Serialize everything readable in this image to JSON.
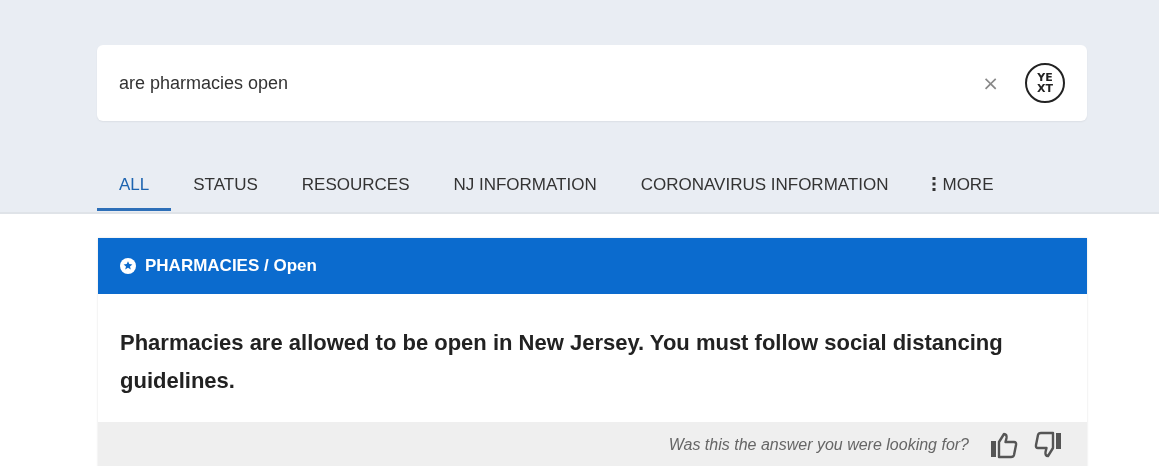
{
  "search": {
    "value": "are pharmacies open",
    "clear": "×",
    "logo_lines": [
      "YE",
      "XT"
    ]
  },
  "tabs": [
    {
      "label": "ALL",
      "selected": true
    },
    {
      "label": "STATUS",
      "selected": false
    },
    {
      "label": "RESOURCES",
      "selected": false
    },
    {
      "label": "NJ INFORMATION",
      "selected": false
    },
    {
      "label": "CORONAVIRUS INFORMATION",
      "selected": false
    },
    {
      "label": "MORE",
      "selected": false,
      "kind": "more"
    }
  ],
  "answer": {
    "header": "PHARMACIES / Open",
    "text": "Pharmacies are allowed to be open in New Jersey. You must follow social distancing guidelines.",
    "feedback": "Was this the answer you were looking for?"
  }
}
